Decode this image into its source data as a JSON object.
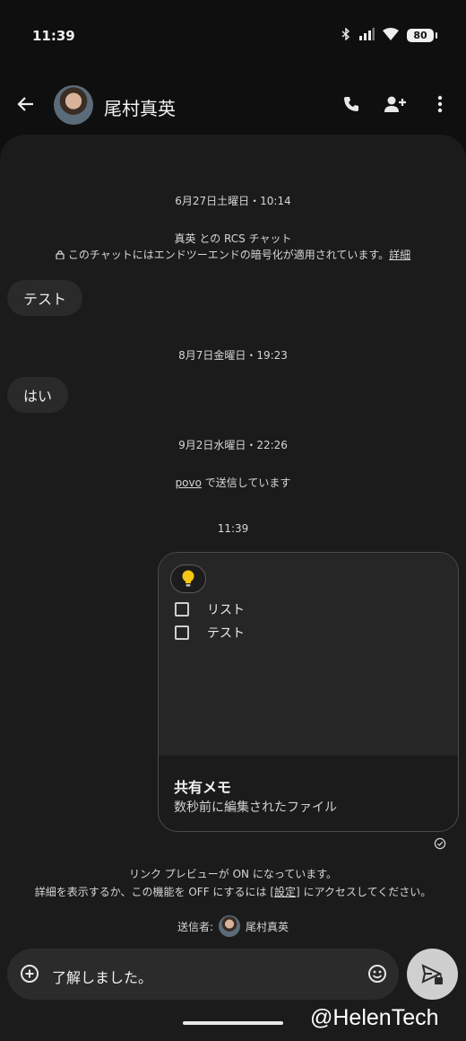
{
  "status": {
    "time": "11:39",
    "battery": "80"
  },
  "header": {
    "contact_name": "尾村真英"
  },
  "messages": {
    "date1": "6月27日土曜日・10:14",
    "rcs_line1": "真英 との RCS チャット",
    "rcs_line2": "このチャットにはエンドツーエンドの暗号化が適用されています。",
    "rcs_details_link": "詳細",
    "bubble1": "テスト",
    "date2": "8月7日金曜日・19:23",
    "bubble2": "はい",
    "date3": "9月2日水曜日・22:26",
    "carrier_link": "povo",
    "carrier_suffix": " で送信しています",
    "time_outgoing": "11:39"
  },
  "card": {
    "items": [
      {
        "label": "リスト"
      },
      {
        "label": "テスト"
      }
    ],
    "title": "共有メモ",
    "subtitle": "数秒前に編集されたファイル"
  },
  "preview_notice": {
    "line1": "リンク プレビューが ON になっています。",
    "line2_prefix": "詳細を表示するか、この機能を OFF にするには ",
    "line2_link": "[設定]",
    "line2_suffix": " にアクセスしてください。"
  },
  "sender": {
    "label": "送信者:",
    "name": "尾村真英"
  },
  "compose": {
    "text": "了解しました。"
  },
  "watermark": "@HelenTech"
}
